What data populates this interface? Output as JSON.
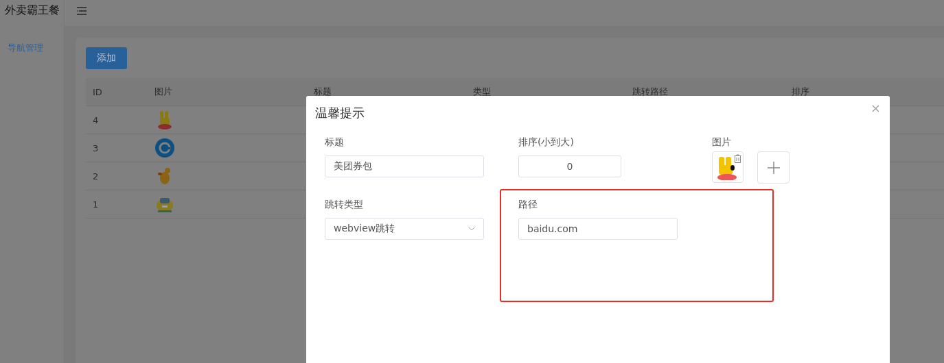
{
  "app": {
    "title": "外卖霸王餐"
  },
  "sidebar": {
    "items": [
      {
        "label": "导航管理",
        "selected": true
      }
    ]
  },
  "toolbar": {
    "add_button": "添加"
  },
  "table": {
    "columns": [
      "ID",
      "图片",
      "标题",
      "类型",
      "跳转路径",
      "排序"
    ],
    "rows": [
      {
        "id": "4"
      },
      {
        "id": "3"
      },
      {
        "id": "2"
      },
      {
        "id": "1"
      }
    ]
  },
  "dialog": {
    "title": "温馨提示",
    "fields": [
      {
        "kind": "text",
        "label": "标题",
        "value": "美团券包"
      },
      {
        "kind": "number",
        "label": "排序(小到大)",
        "value": "0"
      },
      {
        "kind": "upload",
        "label": "图片"
      },
      {
        "kind": "select",
        "label": "跳转类型",
        "value": "webview跳转"
      },
      {
        "kind": "text",
        "label": "路径",
        "value": "baidu.com",
        "highlighted": true
      }
    ]
  }
}
